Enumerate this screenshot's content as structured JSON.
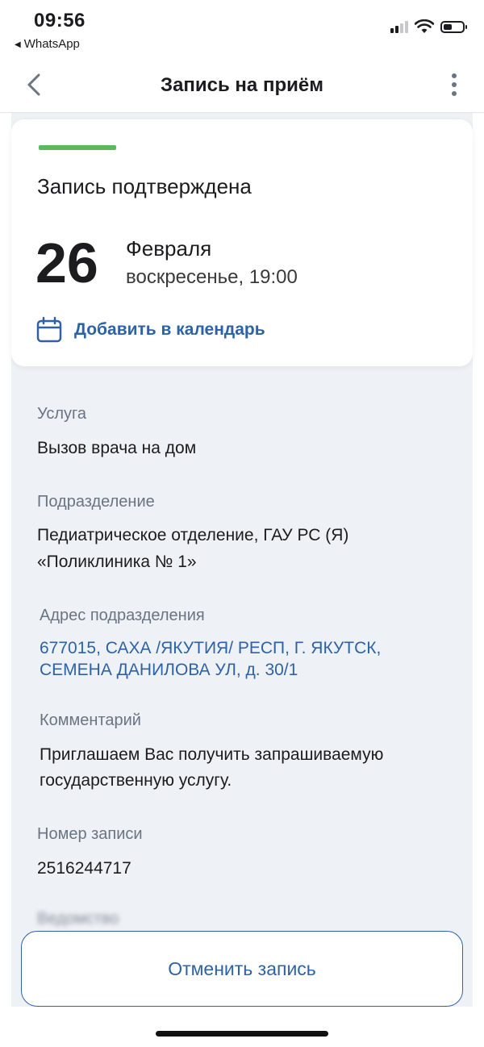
{
  "status_bar": {
    "time": "09:56",
    "back_app": "WhatsApp"
  },
  "nav": {
    "title": "Запись на приём"
  },
  "card": {
    "status_color": "#5cb85c",
    "title": "Запись подтверждена",
    "day": "26",
    "month": "Февраля",
    "weekday_time": "воскресенье, 19:00",
    "add_calendar_label": "Добавить в календарь"
  },
  "details": {
    "service": {
      "label": "Услуга",
      "value": "Вызов врача на дом"
    },
    "department": {
      "label": "Подразделение",
      "line1": "Педиатрическое отделение, ГАУ РС (Я)",
      "line2": "«Поликлиника № 1»"
    },
    "address": {
      "label": "Адрес подразделения",
      "line1": "677015, САХА /ЯКУТИЯ/ РЕСП, Г. ЯКУТСК,",
      "line2": "СЕМЕНА ДАНИЛОВА УЛ, д. 30/1"
    },
    "comment": {
      "label": "Комментарий",
      "line1": "Приглашаем Вас получить запрашиваемую",
      "line2": "государственную услугу."
    },
    "record_number": {
      "label": "Номер записи",
      "value": "2516244717"
    },
    "agency": {
      "label": "Ведомство"
    }
  },
  "actions": {
    "cancel_label": "Отменить запись"
  },
  "colors": {
    "accent": "#2e62a6",
    "background": "#eef1f5",
    "label": "#6b7482"
  }
}
